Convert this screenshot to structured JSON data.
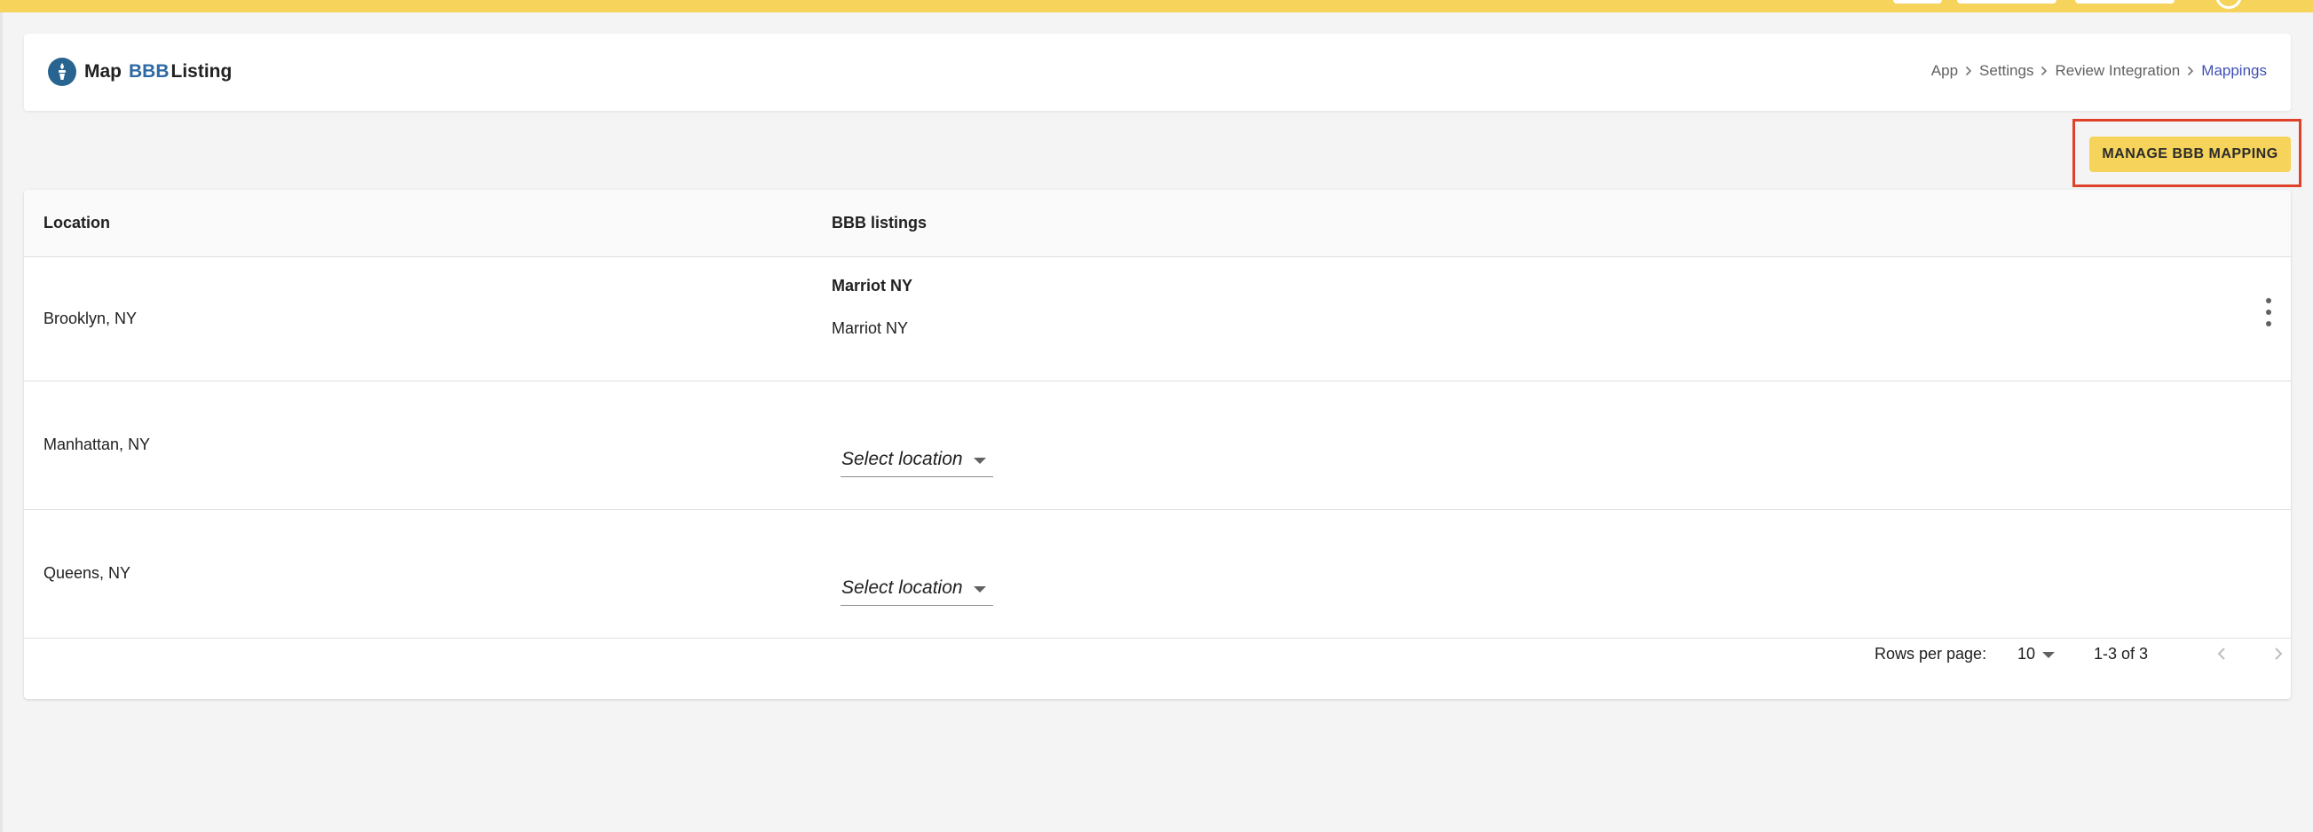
{
  "colors": {
    "accent_yellow": "#f6d35b",
    "brand_blue": "#2f6aa3",
    "breadcrumb_active": "#3f51b5",
    "highlight_red": "#e0412a",
    "background": "#f4f4f5"
  },
  "header": {
    "logo_icon": "bbb-torch-logo-icon",
    "title_prefix": "Map",
    "title_brand": "BBB",
    "title_suffix": "Listing",
    "breadcrumb": [
      {
        "label": "App"
      },
      {
        "label": "Settings"
      },
      {
        "label": "Review Integration"
      },
      {
        "label": "Mappings"
      }
    ]
  },
  "actions": {
    "manage_label": "MANAGE BBB MAPPING"
  },
  "table": {
    "columns": [
      "Location",
      "BBB listings"
    ],
    "rows": [
      {
        "location": "Brooklyn, NY",
        "listing_title": "Marriot NY",
        "listing_name": "Marriot NY",
        "menu_icon": "more-vert-icon"
      },
      {
        "location": "Manhattan, NY",
        "select_placeholder": "Select location"
      },
      {
        "location": "Queens, NY",
        "select_placeholder": "Select location"
      }
    ]
  },
  "pagination": {
    "rows_per_page_label": "Rows per page:",
    "rows_per_page_value": "10",
    "range_label": "1-3 of 3",
    "prev_icon": "chevron-left-icon",
    "next_icon": "chevron-right-icon"
  }
}
